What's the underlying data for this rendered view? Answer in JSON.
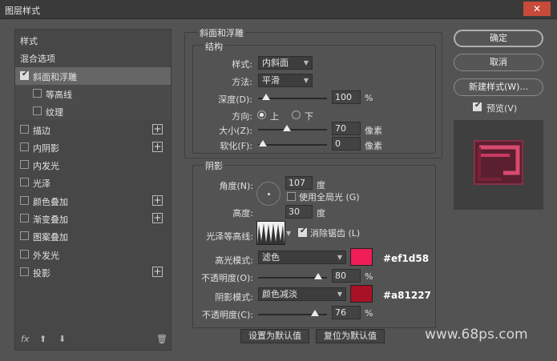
{
  "window": {
    "title": "图层样式",
    "close_glyph": "✕"
  },
  "sidebar": {
    "items": [
      {
        "label": "样式",
        "checkbox": false,
        "checked": false,
        "plus": false
      },
      {
        "label": "混合选项",
        "checkbox": false,
        "checked": false,
        "plus": false
      },
      {
        "label": "斜面和浮雕",
        "checkbox": true,
        "checked": true,
        "plus": false,
        "selected": true
      },
      {
        "label": "等高线",
        "checkbox": true,
        "checked": false,
        "plus": false,
        "sub": true
      },
      {
        "label": "纹理",
        "checkbox": true,
        "checked": false,
        "plus": false,
        "sub": true
      },
      {
        "label": "描边",
        "checkbox": true,
        "checked": false,
        "plus": true
      },
      {
        "label": "内阴影",
        "checkbox": true,
        "checked": false,
        "plus": true
      },
      {
        "label": "内发光",
        "checkbox": true,
        "checked": false,
        "plus": false
      },
      {
        "label": "光泽",
        "checkbox": true,
        "checked": false,
        "plus": false
      },
      {
        "label": "颜色叠加",
        "checkbox": true,
        "checked": false,
        "plus": true
      },
      {
        "label": "渐变叠加",
        "checkbox": true,
        "checked": false,
        "plus": true
      },
      {
        "label": "图案叠加",
        "checkbox": true,
        "checked": false,
        "plus": false
      },
      {
        "label": "外发光",
        "checkbox": true,
        "checked": false,
        "plus": false
      },
      {
        "label": "投影",
        "checkbox": true,
        "checked": false,
        "plus": true
      }
    ],
    "footer": {
      "fx": "fx",
      "up": "⬆",
      "down": "⬇",
      "trash": "🗑"
    }
  },
  "bevel": {
    "group_title": "斜面和浮雕",
    "structure_title": "结构",
    "style_label": "样式:",
    "style_value": "内斜面",
    "technique_label": "方法:",
    "technique_value": "平滑",
    "depth_label": "深度(D):",
    "depth_value": "100",
    "depth_unit": "%",
    "depth_level": 0.05,
    "direction_label": "方向:",
    "direction_up": "上",
    "direction_down": "下",
    "size_label": "大小(Z):",
    "size_value": "70",
    "size_unit": "像素",
    "size_level": 0.35,
    "soften_label": "软化(F):",
    "soften_value": "0",
    "soften_unit": "像素",
    "soften_level": 0.0
  },
  "shading": {
    "title": "阴影",
    "angle_label": "角度(N):",
    "angle_value": "107",
    "angle_unit": "度",
    "global_light_label": "使用全局光 (G)",
    "global_light_checked": false,
    "altitude_label": "高度:",
    "altitude_value": "30",
    "altitude_unit": "度",
    "gloss_label": "光泽等高线:",
    "antialias_label": "消除锯齿 (L)",
    "antialias_checked": true,
    "highlight_label": "高光模式:",
    "highlight_mode": "滤色",
    "highlight_color": "#ef1d58",
    "highlight_hex": "#ef1d58",
    "highlight_opacity_label": "不透明度(O):",
    "highlight_opacity": "80",
    "highlight_opacity_unit": "%",
    "highlight_opacity_level": 0.8,
    "shadow_label": "阴影模式:",
    "shadow_mode": "颜色减淡",
    "shadow_color": "#a81227",
    "shadow_hex": "#a81227",
    "shadow_opacity_label": "不透明度(C):",
    "shadow_opacity": "76",
    "shadow_opacity_unit": "%",
    "shadow_opacity_level": 0.76
  },
  "buttons": {
    "set_default": "设置为默认值",
    "reset_default": "复位为默认值",
    "ok": "确定",
    "cancel": "取消",
    "new_style": "新建样式(W)...",
    "preview_label": "预览(V)",
    "preview_checked": true
  },
  "watermark": "www.68ps.com"
}
